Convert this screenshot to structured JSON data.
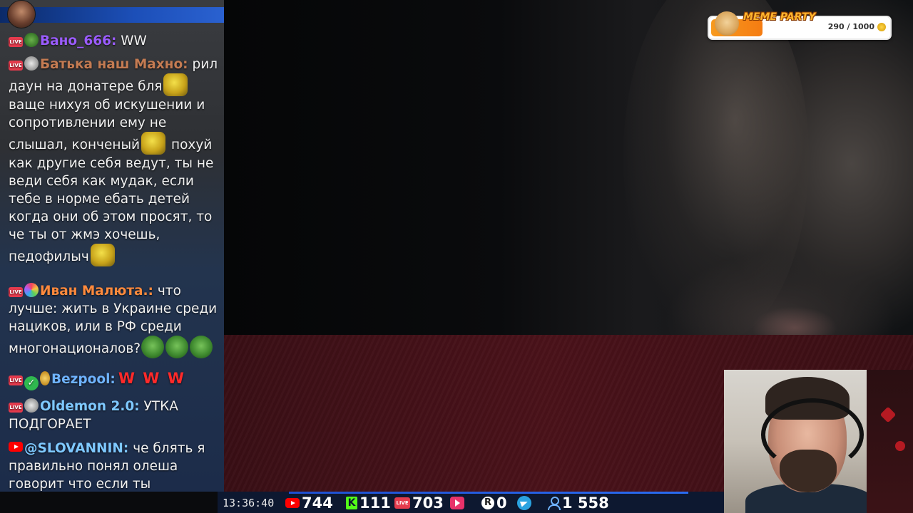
{
  "chat": {
    "messages": [
      {
        "name": "Вано_666:",
        "text": "WW"
      },
      {
        "name": "Батька наш Махно:",
        "text_a": "рил даун на донатере бля",
        "text_b": "ваще нихуя об искушении и сопротивлении ему не слышал, конченый",
        "text_c": "похуй как другие себя ведут, ты не веди себя как мудак, если тебе в норме ебать детей когда они об этом просят, то че ты от жмэ хочешь, педофилыч"
      },
      {
        "name": "Иван Малюта.:",
        "text": "что лучше: жить в Украине среди нациков, или в РФ среди многонационалов?"
      },
      {
        "name": "Bezpool:",
        "text": "W W W"
      },
      {
        "name": "Oldemon 2.0:",
        "text": "УТКА ПОДГОРАЕТ"
      },
      {
        "name": "@SLOVANNIN:",
        "text": "че блять я правильно понял олеша говорит что если ты борешься с педофилией то ты нацист?"
      }
    ],
    "live_badge": "LIVE"
  },
  "meme_party": {
    "title": "MEME PARTY",
    "count": "290 / 1000",
    "progress": 0.29
  },
  "stats": {
    "time": "13:36:40",
    "youtube": "744",
    "kick": "111",
    "live": "703",
    "play": "",
    "r": "0",
    "telegram": "",
    "viewers": "1 558",
    "kick_letter": "K",
    "r_letter": "R",
    "live_label": "LIVE"
  },
  "colors": {
    "accent": "#1c4fb8",
    "live": "#e53b4d",
    "kick": "#53fc18",
    "youtube": "#ff0000"
  }
}
